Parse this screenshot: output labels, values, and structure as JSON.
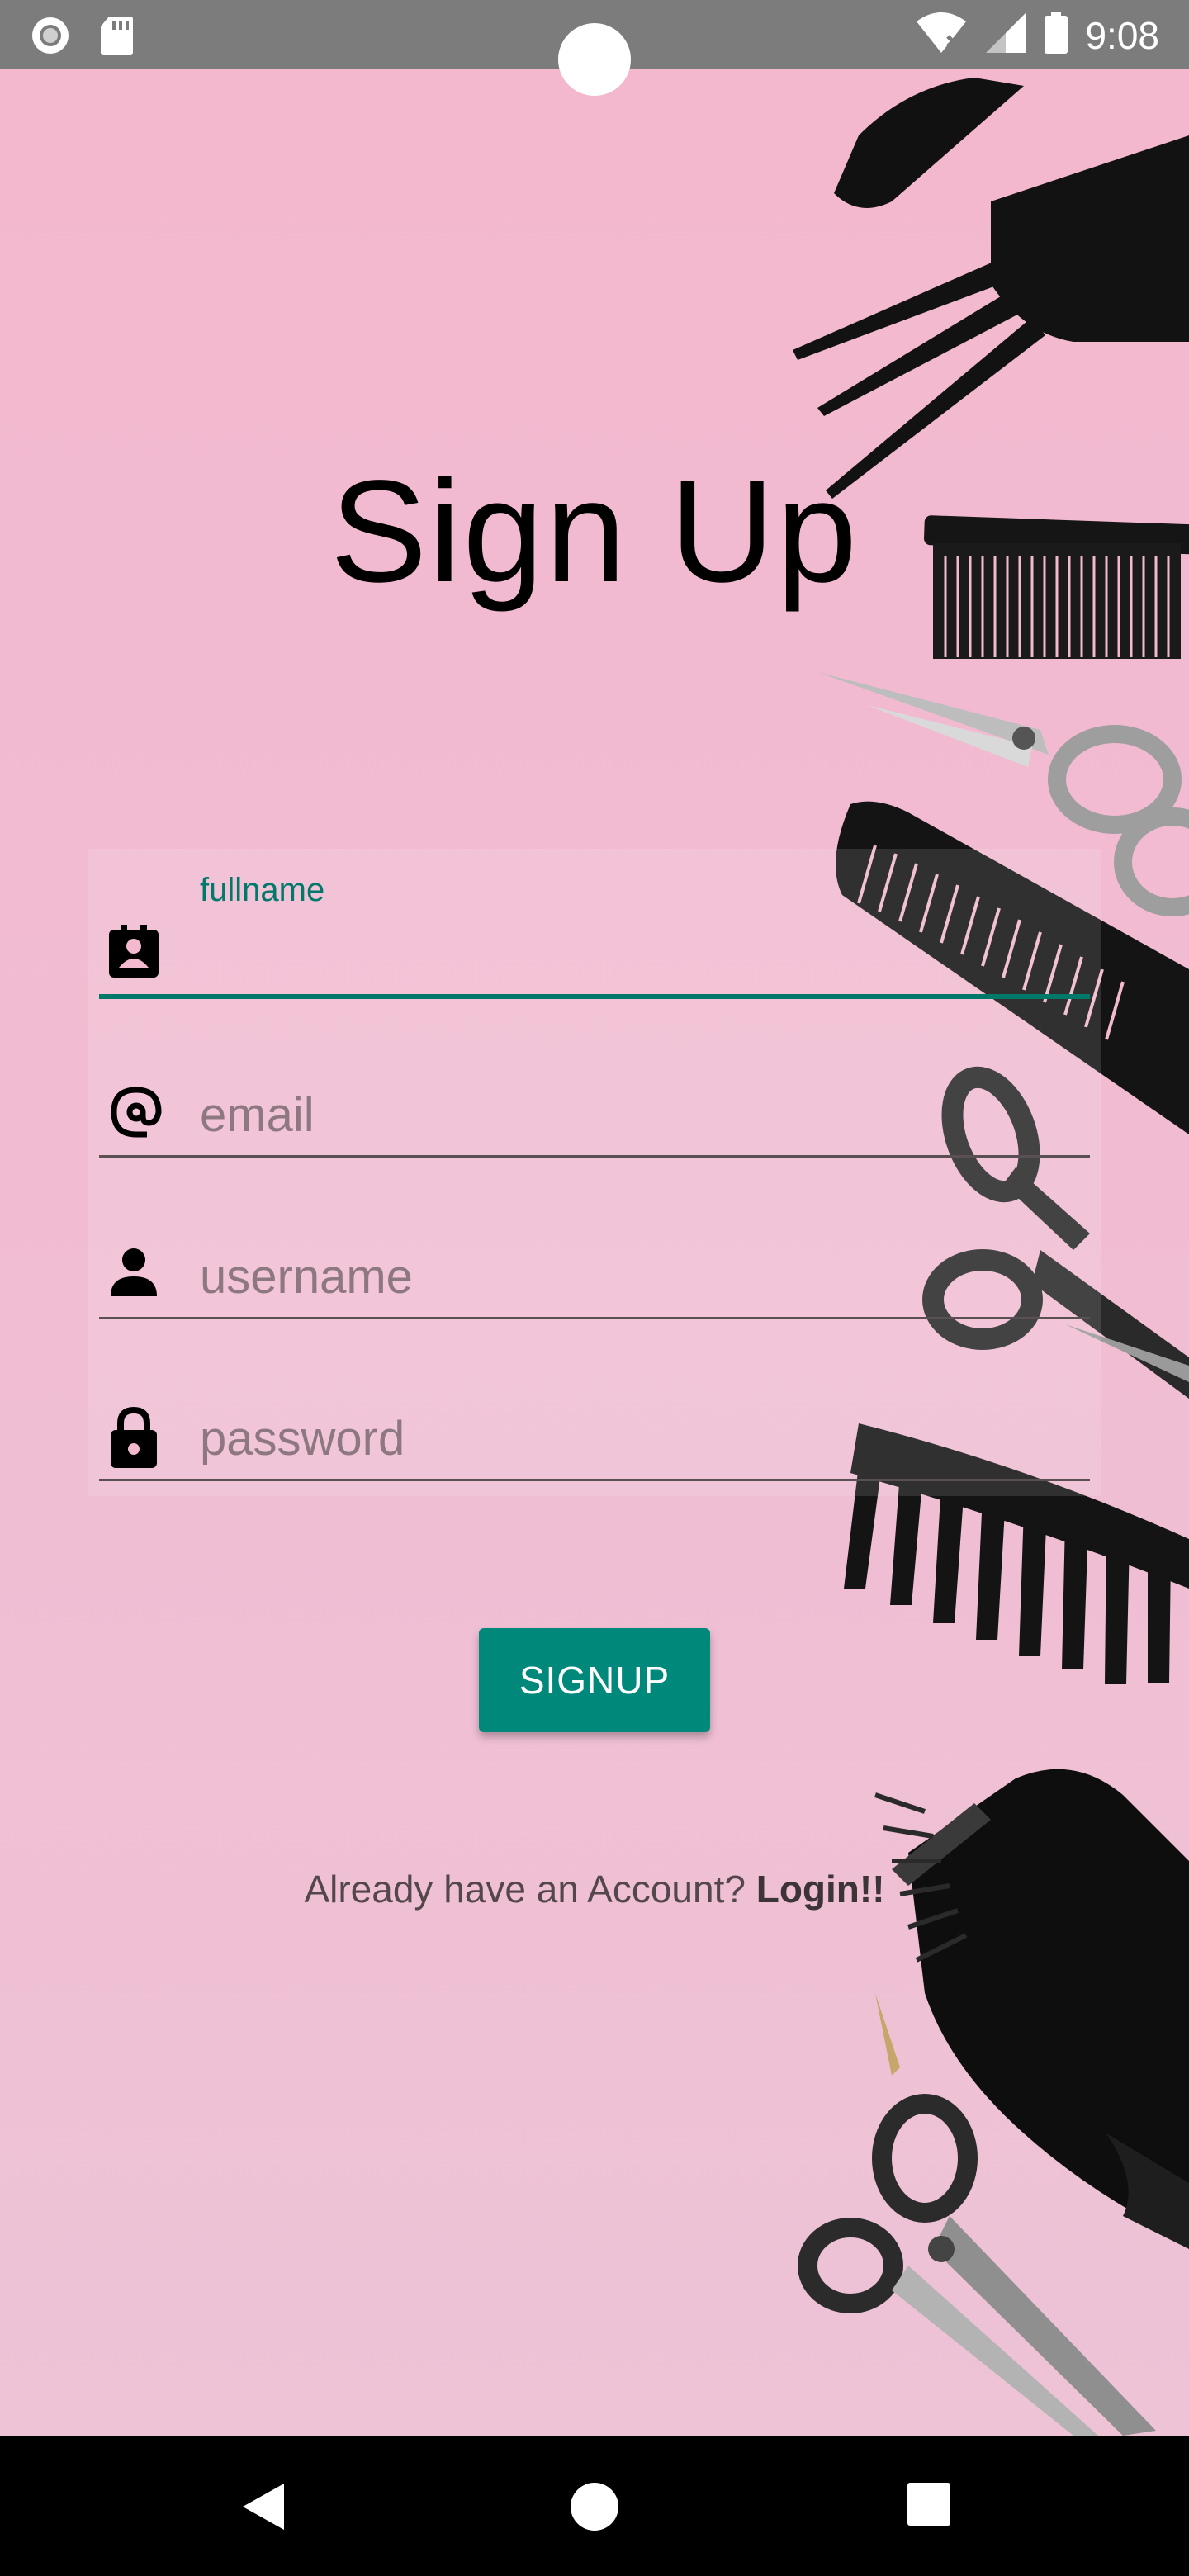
{
  "status_bar": {
    "time": "9:08",
    "left_icons": [
      "record-icon",
      "sd-card-icon"
    ],
    "right_icons": [
      "wifi-icon",
      "cell-signal-icon",
      "battery-icon"
    ]
  },
  "title": "Sign Up",
  "form": {
    "fullname": {
      "label": "fullname",
      "value": "",
      "icon": "contact-card-icon"
    },
    "email": {
      "placeholder": "email",
      "value": "",
      "icon": "at-sign-icon"
    },
    "username": {
      "placeholder": "username",
      "value": "",
      "icon": "person-icon"
    },
    "password": {
      "placeholder": "password",
      "value": "",
      "icon": "lock-icon"
    }
  },
  "signup_button": "SIGNUP",
  "login_prompt": {
    "text": "Already have an Account? ",
    "link": "Login!!"
  },
  "nav_bar": {
    "icons": [
      "back-icon",
      "home-icon",
      "recents-icon"
    ]
  },
  "colors": {
    "accent": "#00897b",
    "focus_line": "#00796b",
    "background_pink": "#f2b9cf"
  }
}
